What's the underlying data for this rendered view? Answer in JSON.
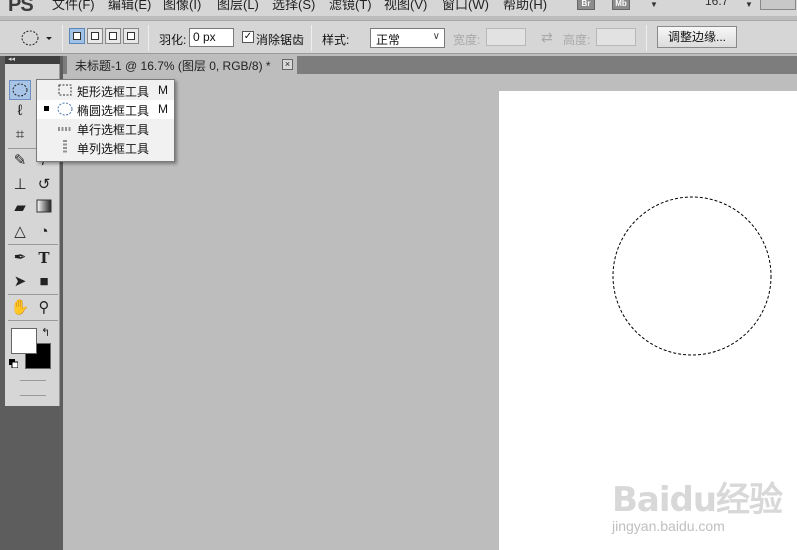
{
  "app": {
    "logo": "PS",
    "zoom": "16.7"
  },
  "menu": [
    "文件(F)",
    "编辑(E)",
    "图像(I)",
    "图层(L)",
    "选择(S)",
    "滤镜(T)",
    "视图(V)",
    "窗口(W)",
    "帮助(H)"
  ],
  "badges": {
    "bridge": "Br",
    "minibridge": "Mb"
  },
  "options": {
    "feather_label": "羽化:",
    "feather_value": "0 px",
    "antialias_label": "消除锯齿",
    "antialias_checked": true,
    "style_label": "样式:",
    "style_value": "正常",
    "width_label": "宽度:",
    "height_label": "高度:",
    "refine_edge": "调整边缘..."
  },
  "document": {
    "tab_title": "未标题-1 @ 16.7% (图层 0, RGB/8) *"
  },
  "flyout": [
    {
      "label": "矩形选框工具",
      "key": "M",
      "icon": "rectangular-marquee-icon",
      "selected": false
    },
    {
      "label": "椭圆选框工具",
      "key": "M",
      "icon": "elliptical-marquee-icon",
      "selected": true
    },
    {
      "label": "单行选框工具",
      "key": "",
      "icon": "single-row-marquee-icon",
      "selected": false
    },
    {
      "label": "单列选框工具",
      "key": "",
      "icon": "single-column-marquee-icon",
      "selected": false
    }
  ],
  "colors": {
    "foreground": "#000000",
    "background": "#ffffff",
    "selected_tool": "#a8c4e6",
    "panel": "#d6d6d6"
  },
  "watermark": {
    "text": "Baidu经验",
    "url": "jingyan.baidu.com"
  }
}
